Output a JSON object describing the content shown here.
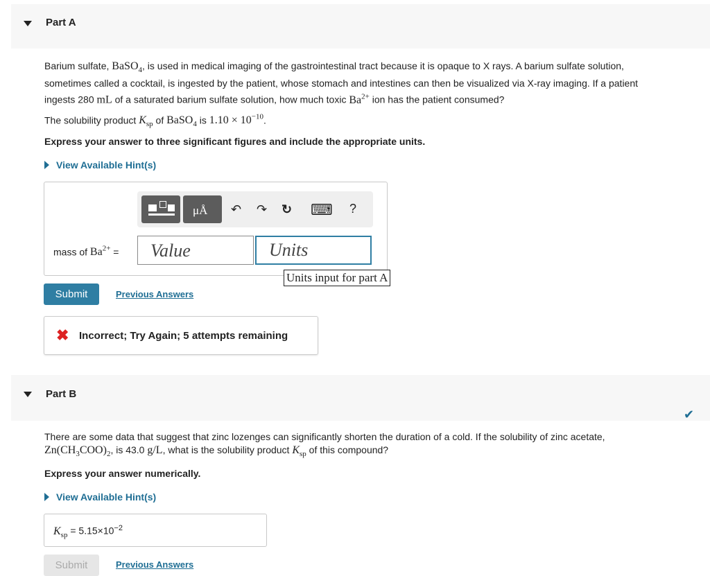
{
  "part_a": {
    "title": "Part A",
    "q1": "Barium sulfate, ",
    "baso4": "BaSO",
    "baso4_sub": "4",
    "q2": ", is used in medical imaging of the gastrointestinal tract because it is opaque to X rays. A barium sulfate solution,",
    "line2": "sometimes called a cocktail, is ingested by the patient, whose stomach and intestines can then be visualized via X-ray imaging. If a patient",
    "line3a": "ingests 280 ",
    "unit_ml": "mL",
    "line3b": " of a saturated barium sulfate solution, how much toxic ",
    "ba": "Ba",
    "ba_sup": "2+",
    "line3c": " ion has the patient consumed?",
    "ksp_a": "The solubility product ",
    "ksp_k": "K",
    "ksp_sub": "sp",
    "ksp_b": " of ",
    "ksp_is": " is ",
    "ksp_val": "1.10 × 10",
    "ksp_exp": "−10",
    "ksp_end": ".",
    "instruction": "Express your answer to three significant figures and include the appropriate units.",
    "hint": "View Available Hint(s)",
    "toolbar": {
      "units_label": "μÅ",
      "undo": "↶",
      "redo": "↷",
      "reset": "↻",
      "keyboard": "⌨",
      "help": "?"
    },
    "answer_label": "mass of ",
    "answer_ba": "Ba",
    "answer_sup": "2+",
    "answer_eq": " =",
    "value_placeholder": "Value",
    "units_placeholder": "Units",
    "units_tooltip": "Units input for part A",
    "submit": "Submit",
    "previous_answers": "Previous Answers",
    "feedback_icon": "✖",
    "feedback": "Incorrect; Try Again; 5 attempts remaining"
  },
  "part_b": {
    "title": "Part B",
    "check": "✔",
    "q1": "There are some data that suggest that zinc lozenges can significantly shorten the duration of a cold. If the solubility of zinc acetate,",
    "formula": "Zn(CH",
    "formula_sub": "3",
    "formula_b": "COO)",
    "formula_sub2": "2",
    "q2": ", is 43.0 ",
    "unit": "g/L",
    "q3": ", what is the solubility product ",
    "ksp_k": "K",
    "ksp_sub": "sp",
    "q4": " of this compound?",
    "instruction": "Express your answer numerically.",
    "hint": "View Available Hint(s)",
    "answer_k": "K",
    "answer_sub": "sp",
    "answer_eq": " = ",
    "answer_val": "5.15×10",
    "answer_exp": "−2",
    "submit": "Submit",
    "previous_answers": "Previous Answers"
  },
  "colors": {
    "accent": "#2f7ea3",
    "link": "#1f6e94",
    "error": "#dd2222",
    "success": "#1f6e94"
  }
}
